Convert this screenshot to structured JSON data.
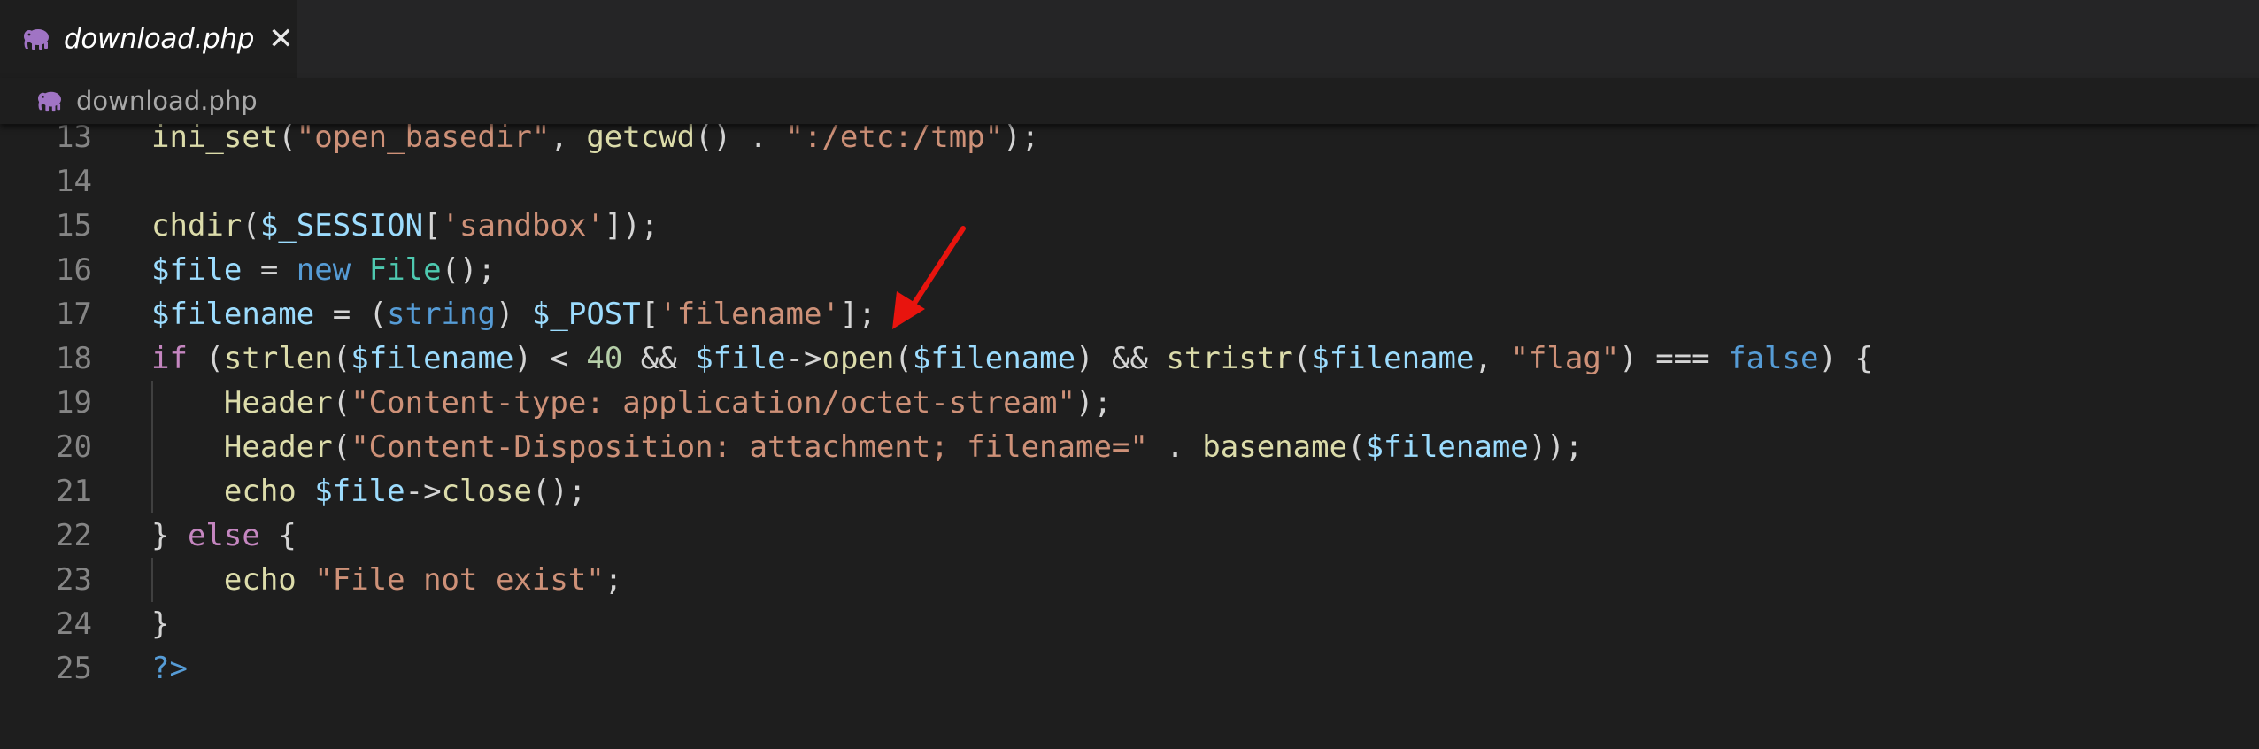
{
  "tab": {
    "label": "download.php",
    "close_glyph": "✕",
    "icon": "php-elephant-icon"
  },
  "breadcrumb": {
    "label": "download.php",
    "icon": "php-elephant-icon"
  },
  "colors": {
    "editor_bg": "#1e1e1e",
    "tabbar_bg": "#252526",
    "line_number": "#858585",
    "arrow": "#e8140e",
    "php_icon": "#a074c4"
  },
  "annotation": {
    "type": "red-arrow",
    "points_to": "open($filename)"
  },
  "lines": [
    {
      "n": "13",
      "tokens": [
        {
          "t": "ini_set",
          "c": "fn"
        },
        {
          "t": "(",
          "c": "punc"
        },
        {
          "t": "\"open_basedir\"",
          "c": "str"
        },
        {
          "t": ", ",
          "c": "punc"
        },
        {
          "t": "getcwd",
          "c": "fn"
        },
        {
          "t": "() . ",
          "c": "punc"
        },
        {
          "t": "\":/etc:/tmp\"",
          "c": "str"
        },
        {
          "t": ");",
          "c": "punc"
        }
      ]
    },
    {
      "n": "14",
      "tokens": []
    },
    {
      "n": "15",
      "tokens": [
        {
          "t": "chdir",
          "c": "fn"
        },
        {
          "t": "(",
          "c": "punc"
        },
        {
          "t": "$_SESSION",
          "c": "var"
        },
        {
          "t": "[",
          "c": "punc"
        },
        {
          "t": "'sandbox'",
          "c": "str"
        },
        {
          "t": "]);",
          "c": "punc"
        }
      ]
    },
    {
      "n": "16",
      "tokens": [
        {
          "t": "$file",
          "c": "var"
        },
        {
          "t": " = ",
          "c": "op"
        },
        {
          "t": "new",
          "c": "kw"
        },
        {
          "t": " ",
          "c": "punc"
        },
        {
          "t": "File",
          "c": "cls"
        },
        {
          "t": "();",
          "c": "punc"
        }
      ]
    },
    {
      "n": "17",
      "tokens": [
        {
          "t": "$filename",
          "c": "var"
        },
        {
          "t": " = (",
          "c": "op"
        },
        {
          "t": "string",
          "c": "kw"
        },
        {
          "t": ") ",
          "c": "punc"
        },
        {
          "t": "$_POST",
          "c": "var"
        },
        {
          "t": "[",
          "c": "punc"
        },
        {
          "t": "'filename'",
          "c": "str"
        },
        {
          "t": "];",
          "c": "punc"
        }
      ]
    },
    {
      "n": "18",
      "tokens": [
        {
          "t": "if",
          "c": "ctl"
        },
        {
          "t": " (",
          "c": "punc"
        },
        {
          "t": "strlen",
          "c": "fn"
        },
        {
          "t": "(",
          "c": "punc"
        },
        {
          "t": "$filename",
          "c": "var"
        },
        {
          "t": ") < ",
          "c": "op"
        },
        {
          "t": "40",
          "c": "num"
        },
        {
          "t": " && ",
          "c": "op"
        },
        {
          "t": "$file",
          "c": "var"
        },
        {
          "t": "->",
          "c": "op"
        },
        {
          "t": "open",
          "c": "fn"
        },
        {
          "t": "(",
          "c": "punc"
        },
        {
          "t": "$filename",
          "c": "var"
        },
        {
          "t": ") && ",
          "c": "op"
        },
        {
          "t": "stristr",
          "c": "fn"
        },
        {
          "t": "(",
          "c": "punc"
        },
        {
          "t": "$filename",
          "c": "var"
        },
        {
          "t": ", ",
          "c": "punc"
        },
        {
          "t": "\"flag\"",
          "c": "str"
        },
        {
          "t": ") === ",
          "c": "op"
        },
        {
          "t": "false",
          "c": "kw"
        },
        {
          "t": ") {",
          "c": "punc"
        }
      ]
    },
    {
      "n": "19",
      "tokens": [
        {
          "t": "    ",
          "c": "punc"
        },
        {
          "t": "Header",
          "c": "fn"
        },
        {
          "t": "(",
          "c": "punc"
        },
        {
          "t": "\"Content-type: application/octet-stream\"",
          "c": "str"
        },
        {
          "t": ");",
          "c": "punc"
        }
      ]
    },
    {
      "n": "20",
      "tokens": [
        {
          "t": "    ",
          "c": "punc"
        },
        {
          "t": "Header",
          "c": "fn"
        },
        {
          "t": "(",
          "c": "punc"
        },
        {
          "t": "\"Content-Disposition: attachment; filename=\"",
          "c": "str"
        },
        {
          "t": " . ",
          "c": "op"
        },
        {
          "t": "basename",
          "c": "fn"
        },
        {
          "t": "(",
          "c": "punc"
        },
        {
          "t": "$filename",
          "c": "var"
        },
        {
          "t": "));",
          "c": "punc"
        }
      ]
    },
    {
      "n": "21",
      "tokens": [
        {
          "t": "    ",
          "c": "punc"
        },
        {
          "t": "echo",
          "c": "fn"
        },
        {
          "t": " ",
          "c": "punc"
        },
        {
          "t": "$file",
          "c": "var"
        },
        {
          "t": "->",
          "c": "op"
        },
        {
          "t": "close",
          "c": "fn"
        },
        {
          "t": "();",
          "c": "punc"
        }
      ]
    },
    {
      "n": "22",
      "tokens": [
        {
          "t": "} ",
          "c": "punc"
        },
        {
          "t": "else",
          "c": "ctl"
        },
        {
          "t": " {",
          "c": "punc"
        }
      ]
    },
    {
      "n": "23",
      "tokens": [
        {
          "t": "    ",
          "c": "punc"
        },
        {
          "t": "echo",
          "c": "fn"
        },
        {
          "t": " ",
          "c": "punc"
        },
        {
          "t": "\"File not exist\"",
          "c": "str"
        },
        {
          "t": ";",
          "c": "punc"
        }
      ]
    },
    {
      "n": "24",
      "tokens": [
        {
          "t": "}",
          "c": "punc"
        }
      ]
    },
    {
      "n": "25",
      "tokens": [
        {
          "t": "?>",
          "c": "tag"
        }
      ]
    }
  ]
}
